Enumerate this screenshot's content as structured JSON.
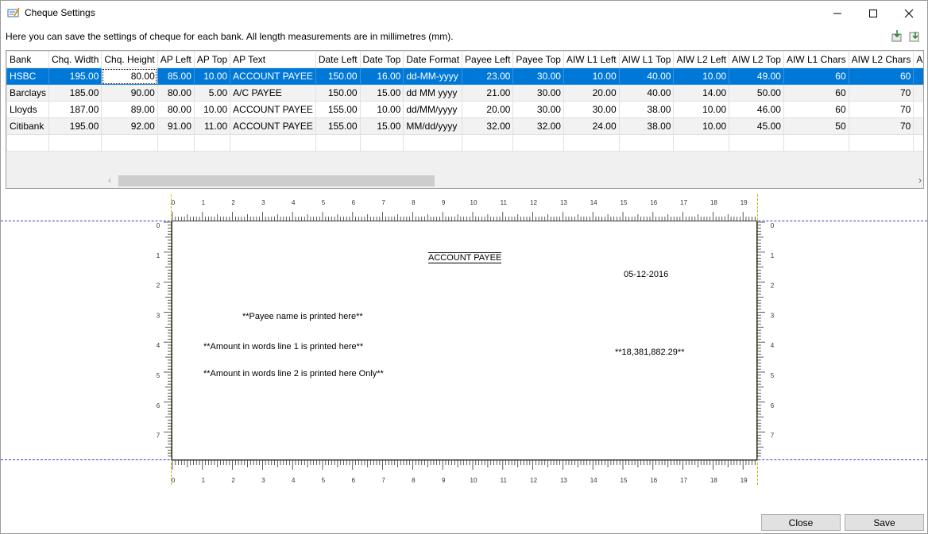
{
  "window": {
    "title": "Cheque Settings",
    "minimize_glyph": "—",
    "maximize_glyph": "☐",
    "close_glyph": "✕"
  },
  "info_text": "Here you can save the settings of cheque for each bank. All length measurements are in millimetres (mm).",
  "toolbar": {
    "import_icon": "import-icon",
    "export_icon": "export-icon"
  },
  "grid": {
    "columns": [
      "Bank",
      "Chq. Width",
      "Chq. Height",
      "AP Left",
      "AP Top",
      "AP Text",
      "Date Left",
      "Date Top",
      "Date Format",
      "Payee Left",
      "Payee Top",
      "AIW L1 Left",
      "AIW L1 Top",
      "AIW L2 Left",
      "AIW L2 Top",
      "AIW L1 Chars",
      "AIW L2 Chars",
      "A"
    ],
    "rows": [
      [
        "HSBC",
        "195.00",
        "80.00",
        "85.00",
        "10.00",
        "ACCOUNT PAYEE",
        "150.00",
        "16.00",
        "dd-MM-yyyy",
        "23.00",
        "30.00",
        "10.00",
        "40.00",
        "10.00",
        "49.00",
        "60",
        "60",
        ""
      ],
      [
        "Barclays",
        "185.00",
        "90.00",
        "80.00",
        "5.00",
        "A/C PAYEE",
        "150.00",
        "15.00",
        "dd MM yyyy",
        "21.00",
        "30.00",
        "20.00",
        "40.00",
        "14.00",
        "50.00",
        "60",
        "70",
        ""
      ],
      [
        "Lloyds",
        "187.00",
        "89.00",
        "80.00",
        "10.00",
        "ACCOUNT PAYEE",
        "155.00",
        "10.00",
        "dd/MM/yyyy",
        "20.00",
        "30.00",
        "30.00",
        "38.00",
        "10.00",
        "46.00",
        "60",
        "70",
        ""
      ],
      [
        "Citibank",
        "195.00",
        "92.00",
        "91.00",
        "11.00",
        "ACCOUNT PAYEE",
        "155.00",
        "15.00",
        "MM/dd/yyyy",
        "32.00",
        "32.00",
        "24.00",
        "38.00",
        "10.00",
        "45.00",
        "50",
        "70",
        ""
      ]
    ],
    "selected_row": 0,
    "scroll_left_glyph": "‹",
    "scroll_right_glyph": "›"
  },
  "preview": {
    "ap_text": "ACCOUNT PAYEE",
    "date": "05-12-2016",
    "payee": "**Payee name is printed here**",
    "aiw1": "**Amount in words line 1 is printed here**",
    "aiw2": "**Amount in words line 2 is printed here Only**",
    "amount": "**18,381,882.29**",
    "h_ruler_labels": [
      "0",
      "1",
      "2",
      "3",
      "4",
      "5",
      "6",
      "7",
      "8",
      "9",
      "10",
      "11",
      "12",
      "13",
      "14",
      "15",
      "16",
      "17",
      "18",
      "19"
    ],
    "v_ruler_labels": [
      "0",
      "1",
      "2",
      "3",
      "4",
      "5",
      "6",
      "7"
    ]
  },
  "buttons": {
    "close": "Close",
    "save": "Save"
  },
  "colors": {
    "selection": "#0078d7",
    "guide_blue": "#3b3bc9",
    "guide_yellow": "#c8b400"
  }
}
